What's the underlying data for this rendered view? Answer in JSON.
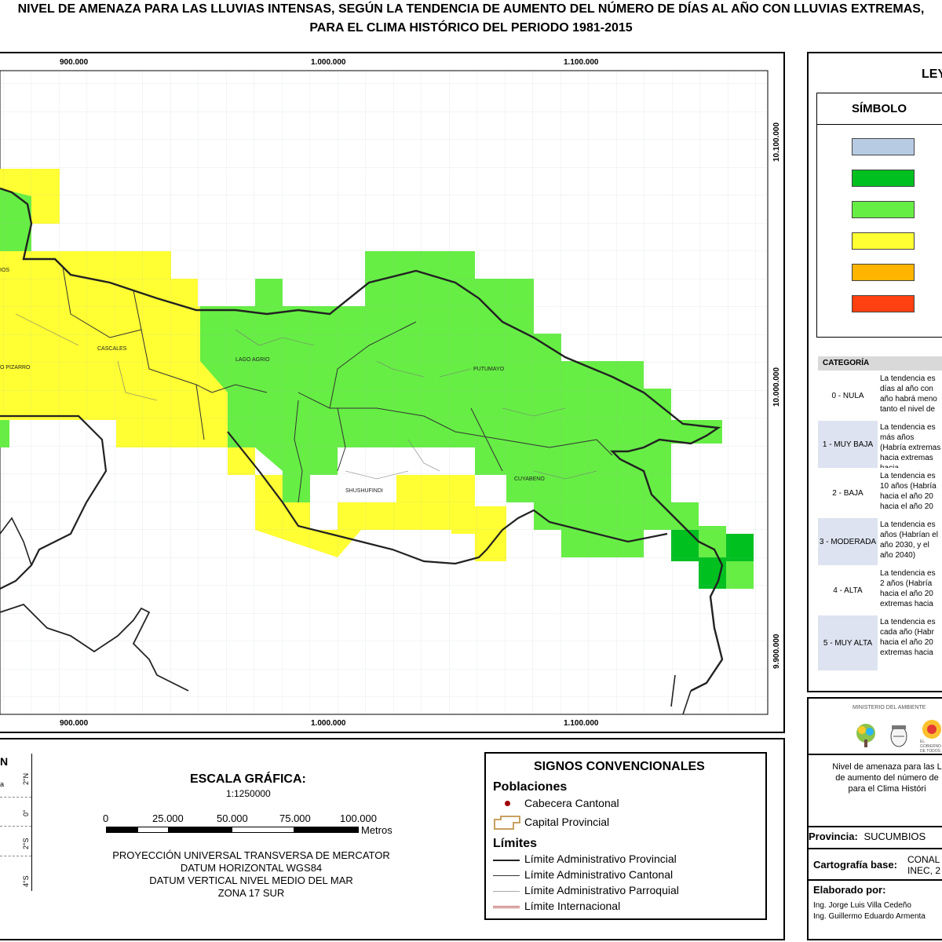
{
  "title": {
    "line1": "NIVEL DE AMENAZA PARA LAS LLUVIAS INTENSAS, SEGÚN LA TENDENCIA DE AUMENTO DEL NÚMERO DE DÍAS AL AÑO CON LLUVIAS EXTREMAS,",
    "line2": "PARA EL CLIMA HISTÓRICO DEL PERIODO 1981-2015"
  },
  "map": {
    "x_ticks_top": [
      "900.000",
      "1.000.000",
      "1.100.000"
    ],
    "x_ticks_bottom": [
      "900.000",
      "1.000.000",
      "1.100.000"
    ],
    "y_ticks": [
      "10.100.000",
      "10.000.000",
      "9.900.000"
    ],
    "places": [
      "CASCALES",
      "LAGO AGRIO",
      "PUTUMAYO",
      "SHUSHUFINDI",
      "CUYABENO",
      "O PIZARRO",
      "IOS"
    ],
    "colors": {
      "nula": "#b7cbe3",
      "muy_baja": "#00c020",
      "baja": "#66ee44",
      "moderada": "#ffff33",
      "alta": "#ffb400",
      "muy_alta": "#ff4010"
    }
  },
  "legend": {
    "heading": "LEY",
    "symbol_col": "SÍMBOLO",
    "category_col": "CATEGORÍA",
    "categories": [
      {
        "name": "0 - NULA",
        "desc": "La tendencia es días al año con año habrá meno tanto el nivel de"
      },
      {
        "name": "1 - MUY BAJA",
        "desc": "La tendencia es más años (Habría extremas hacia extremas hacia"
      },
      {
        "name": "2 - BAJA",
        "desc": "La tendencia es 10 años (Habría hacia el año 20 hacia el año 20"
      },
      {
        "name": "3 - MODERADA",
        "desc": "La tendencia es años (Habrían el año 2030, y el año 2040)"
      },
      {
        "name": "4 - ALTA",
        "desc": "La tendencia es 2 años (Habría hacia el año 20 extremas hacia"
      },
      {
        "name": "5 - MUY ALTA",
        "desc": "La tendencia es cada año (Habr hacia el año 20 extremas hacia"
      }
    ]
  },
  "scale": {
    "title": "ESCALA GRÁFICA:",
    "ratio": "1:1250000",
    "ticks": [
      "0",
      "25.000",
      "50.000",
      "75.000",
      "100.000"
    ],
    "unit": "Metros",
    "proj1": "PROYECCIÓN UNIVERSAL TRANSVERSA DE MERCATOR",
    "proj2": "DATUM HORIZONTAL WGS84",
    "proj3": "DATUM VERTICAL NIVEL MEDIO DEL MAR",
    "proj4": "ZONA 17 SUR"
  },
  "inset": {
    "label": "N",
    "lat_labels": [
      "2°N",
      "0°",
      "2°S",
      "4°S"
    ],
    "side": "a"
  },
  "signs": {
    "title": "SIGNOS CONVENCIONALES",
    "poblaciones": "Poblaciones",
    "cabecera": "Cabecera Cantonal",
    "capital": "Capital Provincial",
    "limites": "Límites",
    "provincial": "Límite Administrativo Provincial",
    "cantonal": "Límite Administrativo Cantonal",
    "parroquial": "Límite Administrativo Parroquial",
    "internacional": "Límite Internacional"
  },
  "info": {
    "ministry": "MINISTERIO DEL AMBIENTE",
    "gov": "EL GOBIERNO DE TODOS",
    "desc1": "Nivel de amenaza para las L",
    "desc2": "de aumento del número de",
    "desc3": "para el Clima Históri",
    "provincia_label": "Provincia:",
    "provincia_value": "SUCUMBIOS",
    "carto_label": "Cartografía base:",
    "carto_value1": "CONAL",
    "carto_value2": "INEC, 2",
    "elaborado_label": "Elaborado por:",
    "author1": "Ing. Jorge Luis Villa Cedeño",
    "author2": "Ing. Guillermo Eduardo Armenta"
  }
}
